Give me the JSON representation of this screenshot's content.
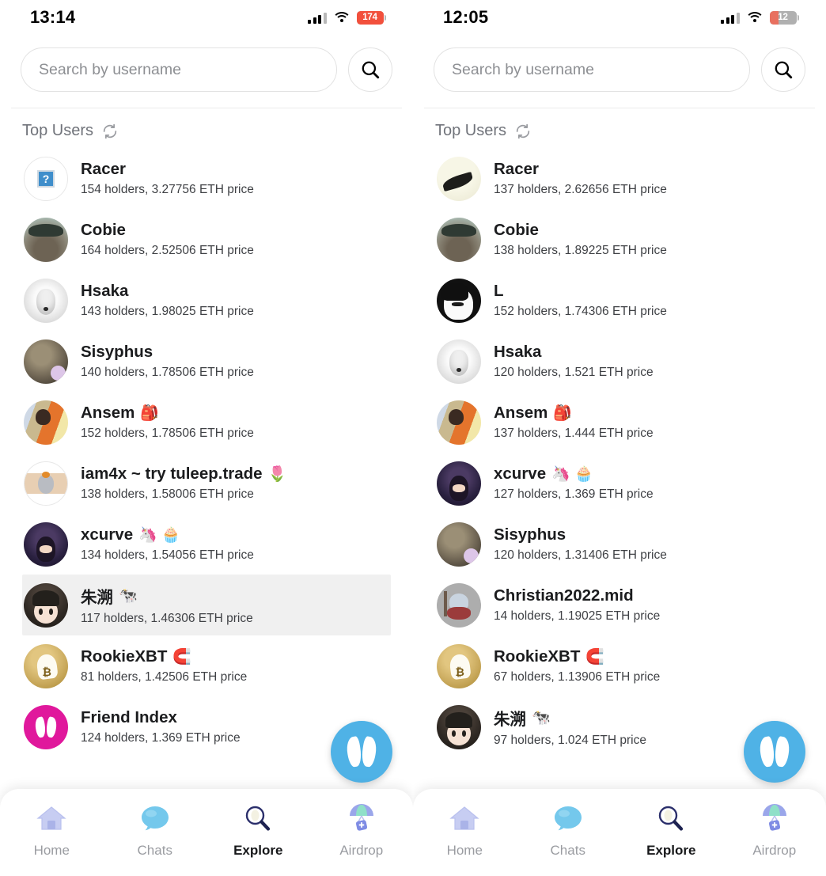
{
  "app": {
    "brand_blue": "#4FB2E6",
    "brand_magenta": "#E0189C",
    "selected_row_bg": "#F0F0F0"
  },
  "panels": [
    {
      "id": "left",
      "status": {
        "time": "13:14",
        "battery_text": "174",
        "battery_percent": 100,
        "battery_color": "#f2503c",
        "signal_icon": "cellular-signal-icon",
        "wifi_icon": "wifi-icon",
        "battery_icon": "battery-icon"
      },
      "search": {
        "placeholder": "Search by username",
        "value": "",
        "button_icon": "search-icon"
      },
      "section": {
        "title": "Top Users",
        "refresh_icon": "refresh-icon"
      },
      "users": [
        {
          "name": "Racer",
          "emoji": "",
          "stats": "154 holders, 3.27756 ETH price",
          "avatar": "placeholder",
          "selected": false
        },
        {
          "name": "Cobie",
          "emoji": "",
          "stats": "164 holders, 2.52506 ETH price",
          "avatar": "photo-cap",
          "selected": false
        },
        {
          "name": "Hsaka",
          "emoji": "",
          "stats": "143 holders, 1.98025 ETH price",
          "avatar": "wolf",
          "selected": false
        },
        {
          "name": "Sisyphus",
          "emoji": "",
          "stats": "140 holders, 1.78506 ETH price",
          "avatar": "statue",
          "selected": false
        },
        {
          "name": "Ansem",
          "emoji": "🎒",
          "stats": "152 holders, 1.78506 ETH price",
          "avatar": "photo-man",
          "selected": false
        },
        {
          "name": "iam4x ~ try tuleep.trade",
          "emoji": "🌷",
          "stats": "138 holders, 1.58006 ETH price",
          "avatar": "pixel-pet",
          "selected": false
        },
        {
          "name": "xcurve",
          "emoji": "🦄 🧁",
          "stats": "134 holders, 1.54056 ETH price",
          "avatar": "anime-dark",
          "selected": false
        },
        {
          "name": "朱溯",
          "emoji": "🐄",
          "stats": "117 holders, 1.46306 ETH price",
          "avatar": "anime-girl",
          "selected": true
        },
        {
          "name": "RookieXBT",
          "emoji": "🧲",
          "stats": "81 holders, 1.42506 ETH price",
          "avatar": "gold-ghost",
          "selected": false
        },
        {
          "name": "Friend Index",
          "emoji": "",
          "stats": "124 holders, 1.369 ETH price",
          "avatar": "brand-pink",
          "selected": false
        }
      ],
      "fab": {
        "icon": "friendtech-logo-icon"
      },
      "tabs": [
        {
          "label": "Home",
          "icon": "home-icon",
          "active": false
        },
        {
          "label": "Chats",
          "icon": "chat-icon",
          "active": false
        },
        {
          "label": "Explore",
          "icon": "search-icon",
          "active": true
        },
        {
          "label": "Airdrop",
          "icon": "parachute-icon",
          "active": false
        }
      ]
    },
    {
      "id": "right",
      "status": {
        "time": "12:05",
        "battery_text": "12",
        "battery_percent": 34,
        "battery_color": "#e8705f",
        "signal_icon": "cellular-signal-icon",
        "wifi_icon": "wifi-icon",
        "battery_icon": "battery-icon"
      },
      "search": {
        "placeholder": "Search by username",
        "value": "",
        "button_icon": "search-icon"
      },
      "section": {
        "title": "Top Users",
        "refresh_icon": "refresh-icon"
      },
      "users": [
        {
          "name": "Racer",
          "emoji": "",
          "stats": "137 holders, 2.62656 ETH price",
          "avatar": "cream-swoosh",
          "selected": false
        },
        {
          "name": "Cobie",
          "emoji": "",
          "stats": "138 holders, 1.89225 ETH price",
          "avatar": "photo-cap",
          "selected": false
        },
        {
          "name": "L",
          "emoji": "",
          "stats": "152 holders, 1.74306 ETH price",
          "avatar": "bw-anime",
          "selected": false
        },
        {
          "name": "Hsaka",
          "emoji": "",
          "stats": "120 holders, 1.521 ETH price",
          "avatar": "wolf",
          "selected": false
        },
        {
          "name": "Ansem",
          "emoji": "🎒",
          "stats": "137 holders, 1.444 ETH price",
          "avatar": "photo-man",
          "selected": false
        },
        {
          "name": "xcurve",
          "emoji": "🦄 🧁",
          "stats": "127 holders, 1.369 ETH price",
          "avatar": "anime-dark",
          "selected": false
        },
        {
          "name": "Sisyphus",
          "emoji": "",
          "stats": "120 holders, 1.31406 ETH price",
          "avatar": "statue",
          "selected": false
        },
        {
          "name": "Christian2022.mid",
          "emoji": "",
          "stats": "14 holders, 1.19025 ETH price",
          "avatar": "gray-bot",
          "selected": false
        },
        {
          "name": "RookieXBT",
          "emoji": "🧲",
          "stats": "67 holders, 1.13906 ETH price",
          "avatar": "gold-ghost",
          "selected": false
        },
        {
          "name": "朱溯",
          "emoji": "🐄",
          "stats": "97 holders, 1.024 ETH price",
          "avatar": "anime-girl",
          "selected": false
        }
      ],
      "fab": {
        "icon": "friendtech-logo-icon"
      },
      "tabs": [
        {
          "label": "Home",
          "icon": "home-icon",
          "active": false
        },
        {
          "label": "Chats",
          "icon": "chat-icon",
          "active": false
        },
        {
          "label": "Explore",
          "icon": "search-icon",
          "active": true
        },
        {
          "label": "Airdrop",
          "icon": "parachute-icon",
          "active": false
        }
      ]
    }
  ]
}
